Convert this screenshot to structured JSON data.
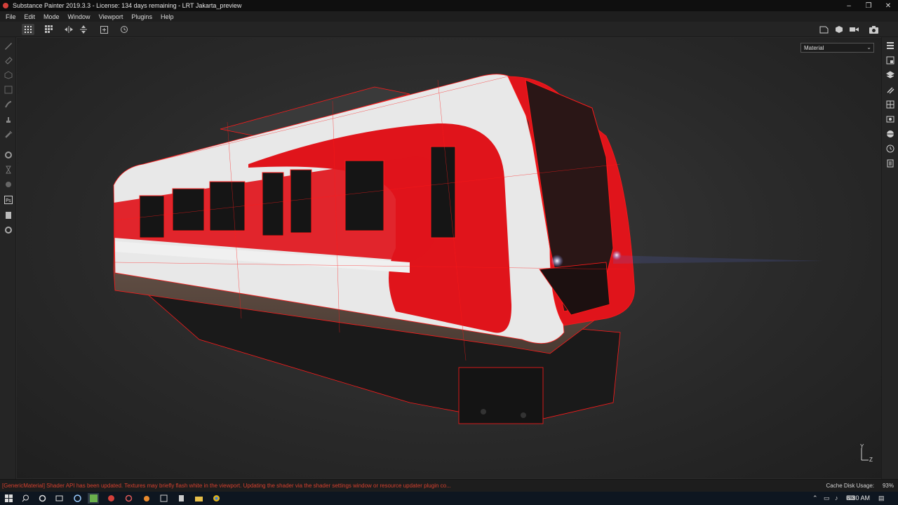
{
  "window": {
    "title": "Substance Painter 2019.3.3 - License: 134 days remaining - LRT Jakarta_preview",
    "minimize": "–",
    "maximize": "❐",
    "close": "✕"
  },
  "menu": {
    "items": [
      "File",
      "Edit",
      "Mode",
      "Window",
      "Viewport",
      "Plugins",
      "Help"
    ]
  },
  "viewport": {
    "mode_select": "Material",
    "axis_y": "Y",
    "axis_z": "Z",
    "model_color": "#e0141b",
    "wire_color": "#ff1a1a"
  },
  "status": {
    "message": "[GenericMaterial] Shader API has been updated. Textures may briefly flash white in the viewport. Updating the shader via the shader settings window or resource updater plugin co...",
    "cache_label": "Cache Disk Usage:",
    "cache_value": "93%"
  },
  "taskbar": {
    "clock": "6:30 AM"
  },
  "colors": {
    "accent_red": "#d5402e",
    "panel_dark": "#252525",
    "viewport_bg": "#2b2b2b"
  }
}
